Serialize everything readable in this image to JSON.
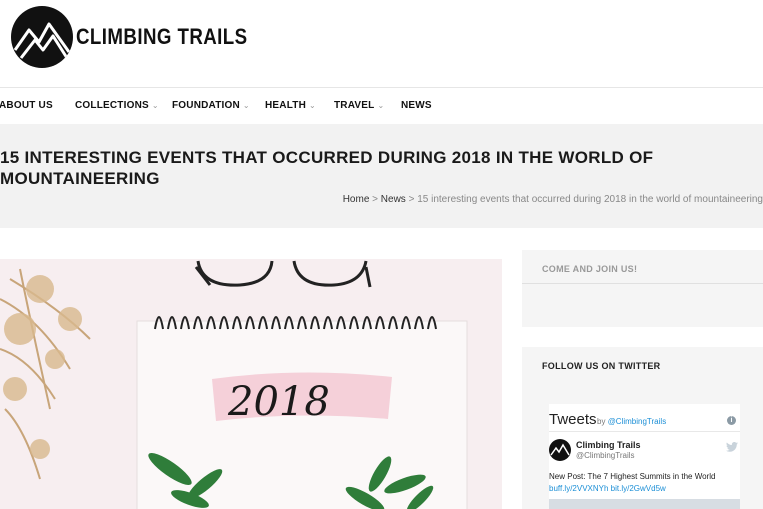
{
  "site": {
    "logo_text": "CLIMBING TRAILS"
  },
  "nav": {
    "items": [
      {
        "label": "ABOUT US",
        "has_dropdown": false
      },
      {
        "label": "COLLECTIONS",
        "has_dropdown": true
      },
      {
        "label": "FOUNDATION",
        "has_dropdown": true
      },
      {
        "label": "HEALTH",
        "has_dropdown": true
      },
      {
        "label": "TRAVEL",
        "has_dropdown": true
      },
      {
        "label": "NEWS",
        "has_dropdown": false
      }
    ]
  },
  "post": {
    "title": "15 INTERESTING EVENTS THAT OCCURRED DURING 2018 IN THE WORLD OF MOUNTAINEERING",
    "breadcrumb": {
      "home": "Home",
      "separator": ">",
      "section": "News",
      "current": "15 interesting events that occurred during 2018 in the world of mountaineering"
    },
    "image_text": "2018"
  },
  "sidebar": {
    "join_title": "COME AND JOIN US!",
    "twitter_title": "FOLLOW US ON TWITTER",
    "twitter": {
      "heading": "Tweets",
      "by": "by",
      "handle": "@ClimbingTrails",
      "account_name": "Climbing Trails",
      "screen_name": "@ClimbingTrails",
      "tweet_text": "New Post: The 7 Highest Summits in the World",
      "tweet_links": "buff.ly/2VVXNYh bit.ly/2GwVd5w"
    }
  },
  "colors": {
    "link_blue": "#1c8fd6",
    "title_band": "#f2f2f2",
    "sidebar_bg": "#f5f5f5"
  }
}
